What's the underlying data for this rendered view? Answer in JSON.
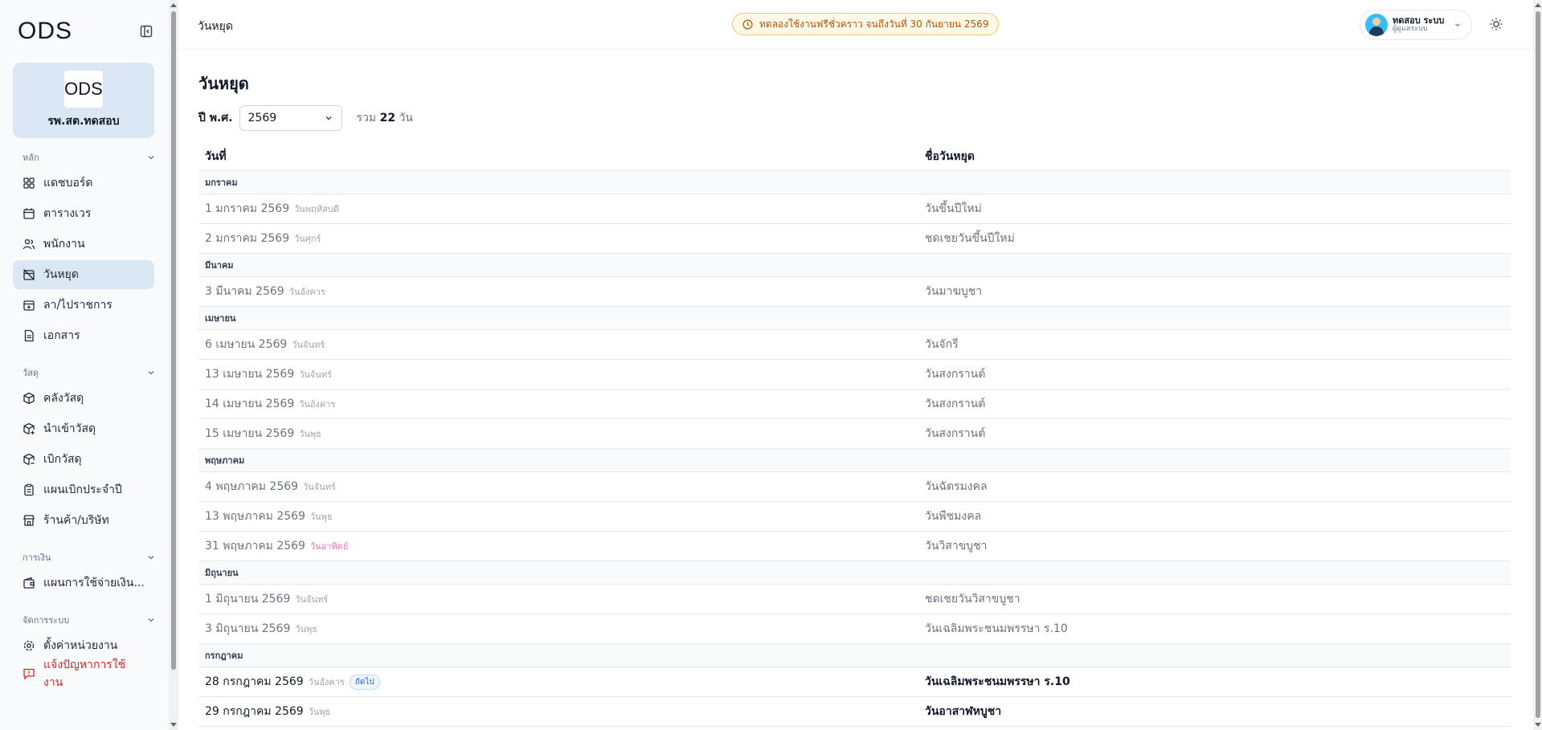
{
  "sidebar": {
    "logo": "ODS",
    "org_name": "รพ.สต.ทดสอบ",
    "sections": {
      "main": {
        "title": "หลัก",
        "items": [
          {
            "label": "แดชบอร์ด"
          },
          {
            "label": "ตารางเวร"
          },
          {
            "label": "พนักงาน"
          },
          {
            "label": "วันหยุด"
          },
          {
            "label": "ลา/ไปราชการ"
          },
          {
            "label": "เอกสาร"
          }
        ]
      },
      "supplies": {
        "title": "วัสดุ",
        "items": [
          {
            "label": "คลังวัสดุ"
          },
          {
            "label": "นำเข้าวัสดุ"
          },
          {
            "label": "เบิกวัสดุ"
          },
          {
            "label": "แผนเบิกประจำปี"
          },
          {
            "label": "ร้านค้า/บริษัท"
          }
        ]
      },
      "finance": {
        "title": "การเงิน",
        "items": [
          {
            "label": "แผนการใช้จ่ายเงิน..."
          }
        ]
      },
      "system": {
        "title": "จัดการระบบ",
        "items": [
          {
            "label": "ตั้งค่าหน่วยงาน"
          },
          {
            "label": "แจ้งปัญหาการใช้งาน"
          }
        ]
      }
    }
  },
  "header": {
    "title": "วันหยุด",
    "trial_notice": "ทดลองใช้งานฟรีชั่วคราว จนถึงวันที่ 30 กันยายน 2569",
    "user_name": "ทดสอบ ระบบ",
    "user_role": "ผู้ดูแลระบบ"
  },
  "main": {
    "page_title": "วันหยุด",
    "year_label": "ปี พ.ศ.",
    "year_value": "2569",
    "total_prefix": "รวม",
    "total_count": "22",
    "total_suffix": "วัน",
    "col_date": "วันที่",
    "col_name": "ชื่อวันหยุด",
    "months": [
      {
        "month": "มกราคม",
        "rows": [
          {
            "date": "1 มกราคม 2569",
            "weekday": "วันพฤหัสบดี",
            "name": "วันขึ้นปีใหม่"
          },
          {
            "date": "2 มกราคม 2569",
            "weekday": "วันศุกร์",
            "name": "ชดเชยวันขึ้นปีใหม่"
          }
        ]
      },
      {
        "month": "มีนาคม",
        "rows": [
          {
            "date": "3 มีนาคม 2569",
            "weekday": "วันอังคาร",
            "name": "วันมาฆบูชา"
          }
        ]
      },
      {
        "month": "เมษายน",
        "rows": [
          {
            "date": "6 เมษายน 2569",
            "weekday": "วันจันทร์",
            "name": "วันจักรี"
          },
          {
            "date": "13 เมษายน 2569",
            "weekday": "วันจันทร์",
            "name": "วันสงกรานต์"
          },
          {
            "date": "14 เมษายน 2569",
            "weekday": "วันอังคาร",
            "name": "วันสงกรานต์"
          },
          {
            "date": "15 เมษายน 2569",
            "weekday": "วันพุธ",
            "name": "วันสงกรานต์"
          }
        ]
      },
      {
        "month": "พฤษภาคม",
        "rows": [
          {
            "date": "4 พฤษภาคม 2569",
            "weekday": "วันจันทร์",
            "name": "วันฉัตรมงคล"
          },
          {
            "date": "13 พฤษภาคม 2569",
            "weekday": "วันพุธ",
            "name": "วันพืชมงคล"
          },
          {
            "date": "31 พฤษภาคม 2569",
            "weekday": "วันอาทิตย์",
            "name": "วันวิสาขบูชา",
            "sunday": true
          }
        ]
      },
      {
        "month": "มิถุนายน",
        "rows": [
          {
            "date": "1 มิถุนายน 2569",
            "weekday": "วันจันทร์",
            "name": "ชดเชยวันวิสาขบูชา"
          },
          {
            "date": "3 มิถุนายน 2569",
            "weekday": "วันพุธ",
            "name": "วันเฉลิมพระชนมพรรษา ร.10"
          }
        ]
      },
      {
        "month": "กรกฎาคม",
        "rows": [
          {
            "date": "28 กรกฎาคม 2569",
            "weekday": "วันอังคาร",
            "name": "วันเฉลิมพระชนมพรรษา ร.10",
            "upcoming": true,
            "badge": "ถัดไป"
          },
          {
            "date": "29 กรกฎาคม 2569",
            "weekday": "วันพุธ",
            "name": "วันอาสาฬหบูชา",
            "upcoming": true
          }
        ]
      }
    ]
  }
}
